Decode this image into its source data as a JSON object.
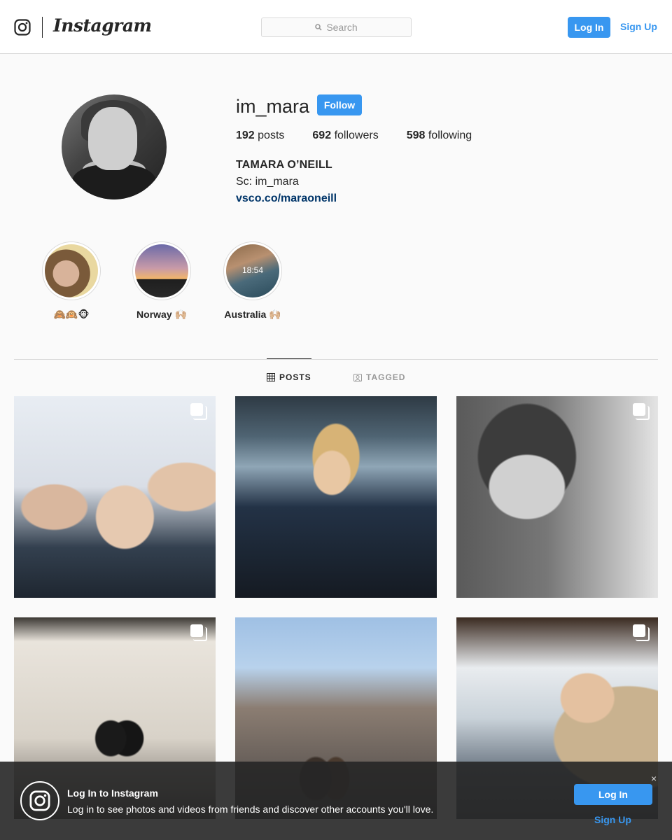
{
  "header": {
    "wordmark": "Instagram",
    "search_placeholder": "Search",
    "login_label": "Log In",
    "signup_label": "Sign Up"
  },
  "profile": {
    "username": "im_mara",
    "follow_label": "Follow",
    "posts_count": "192",
    "posts_label": "posts",
    "followers_count": "692",
    "followers_label": "followers",
    "following_count": "598",
    "following_label": "following",
    "full_name": "TAMARA O’NEILL",
    "bio": "Sc: im_mara",
    "website": "vsco.co/maraoneill"
  },
  "highlights": [
    {
      "label": "🙈🙉🐵"
    },
    {
      "label": "Norway 🙌🏼"
    },
    {
      "label": "Australia 🙌🏼",
      "time_text": "18:54"
    }
  ],
  "tabs": [
    {
      "label": "POSTS",
      "active": true
    },
    {
      "label": "TAGGED",
      "active": false
    }
  ],
  "banner": {
    "title": "Log In to Instagram",
    "subtitle": "Log in to see photos and videos from friends and discover other accounts you'll love.",
    "close_glyph": "×",
    "login_label": "Log In",
    "signup_label": "Sign Up"
  },
  "colors": {
    "accent": "#3897f0",
    "link": "#003569",
    "text": "#262626",
    "muted": "#999999",
    "border": "#dbdbdb"
  }
}
